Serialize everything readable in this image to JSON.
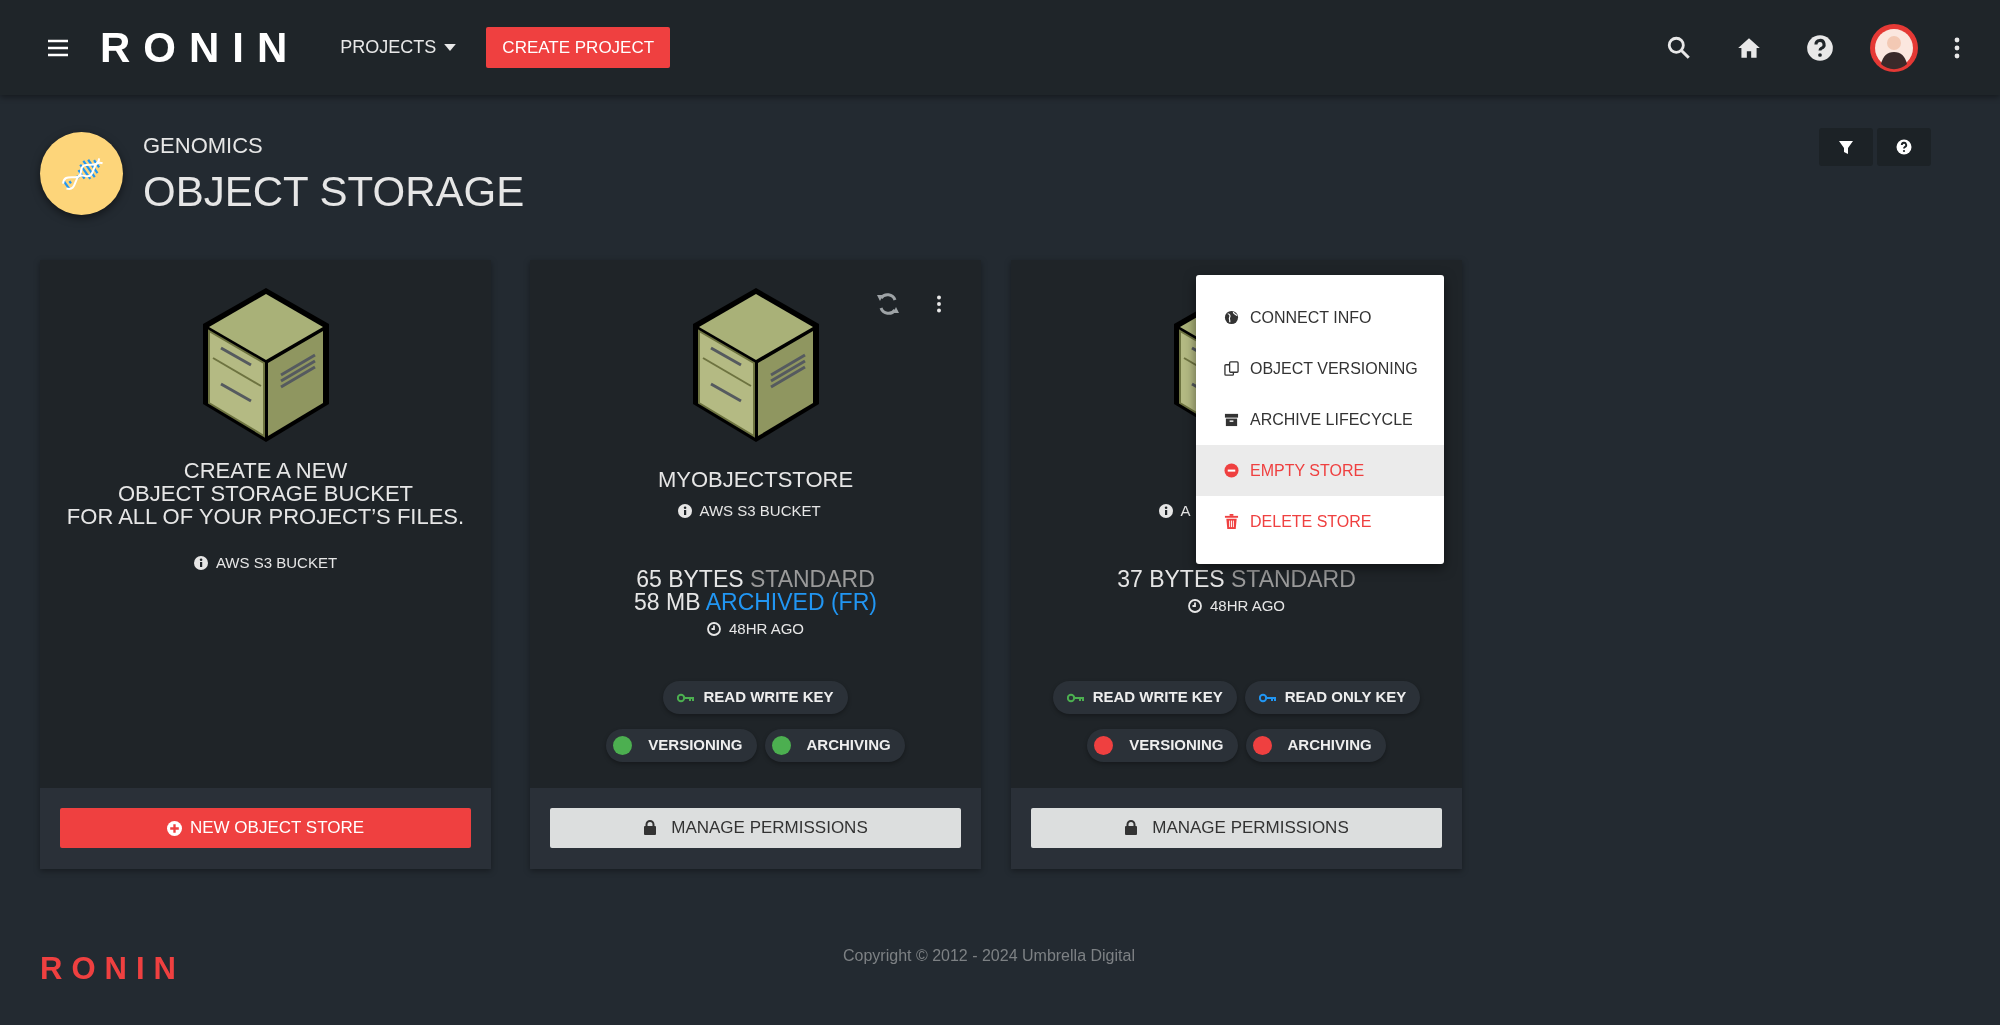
{
  "header": {
    "logo": "RONIN",
    "projects_menu": "PROJECTS",
    "create_button": "CREATE PROJECT"
  },
  "page": {
    "project": "GENOMICS",
    "title": "OBJECT STORAGE"
  },
  "cards": [
    {
      "kind": "create",
      "description": [
        "CREATE A NEW",
        "OBJECT STORAGE BUCKET",
        "FOR ALL OF YOUR PROJECT’S FILES."
      ],
      "type": "AWS S3 BUCKET",
      "button": {
        "label": "NEW OBJECT STORE",
        "kind": "primary"
      }
    },
    {
      "kind": "store",
      "toolbar": true,
      "name": "MYOBJECTSTORE",
      "type": "AWS S3 BUCKET",
      "usage": [
        {
          "amount": "65 BYTES",
          "tier": "STANDARD",
          "color": "#9a9a9a"
        },
        {
          "amount": "58 MB",
          "tier": "ARCHIVED (FR)",
          "color": "#2196f3"
        }
      ],
      "updated": "48HR AGO",
      "keys": [
        {
          "label": "READ WRITE KEY",
          "color": "#4caf50"
        }
      ],
      "features": [
        {
          "label": "VERSIONING",
          "on": true
        },
        {
          "label": "ARCHIVING",
          "on": true
        }
      ],
      "button": {
        "label": "MANAGE PERMISSIONS",
        "kind": "secondary"
      }
    },
    {
      "kind": "store",
      "toolbar": false,
      "type": "A",
      "usage": [
        {
          "amount": "37 BYTES",
          "tier": "STANDARD",
          "color": "#9a9a9a"
        }
      ],
      "updated": "48HR AGO",
      "keys": [
        {
          "label": "READ WRITE KEY",
          "color": "#4caf50"
        },
        {
          "label": "READ ONLY KEY",
          "color": "#2196f3"
        }
      ],
      "features": [
        {
          "label": "VERSIONING",
          "on": false
        },
        {
          "label": "ARCHIVING",
          "on": false
        }
      ],
      "button": {
        "label": "MANAGE PERMISSIONS",
        "kind": "secondary"
      },
      "menu": [
        {
          "label": "CONNECT INFO",
          "kind": "normal",
          "highlighted": false
        },
        {
          "label": "OBJECT VERSIONING",
          "kind": "normal",
          "highlighted": false
        },
        {
          "label": "ARCHIVE LIFECYCLE",
          "kind": "normal",
          "highlighted": false
        },
        {
          "label": "EMPTY STORE",
          "kind": "danger",
          "highlighted": true
        },
        {
          "label": "DELETE STORE",
          "kind": "danger",
          "highlighted": false
        }
      ]
    }
  ],
  "footer": {
    "logo": "RONIN",
    "copyright": "Copyright © 2012 - 2024 Umbrella Digital"
  }
}
